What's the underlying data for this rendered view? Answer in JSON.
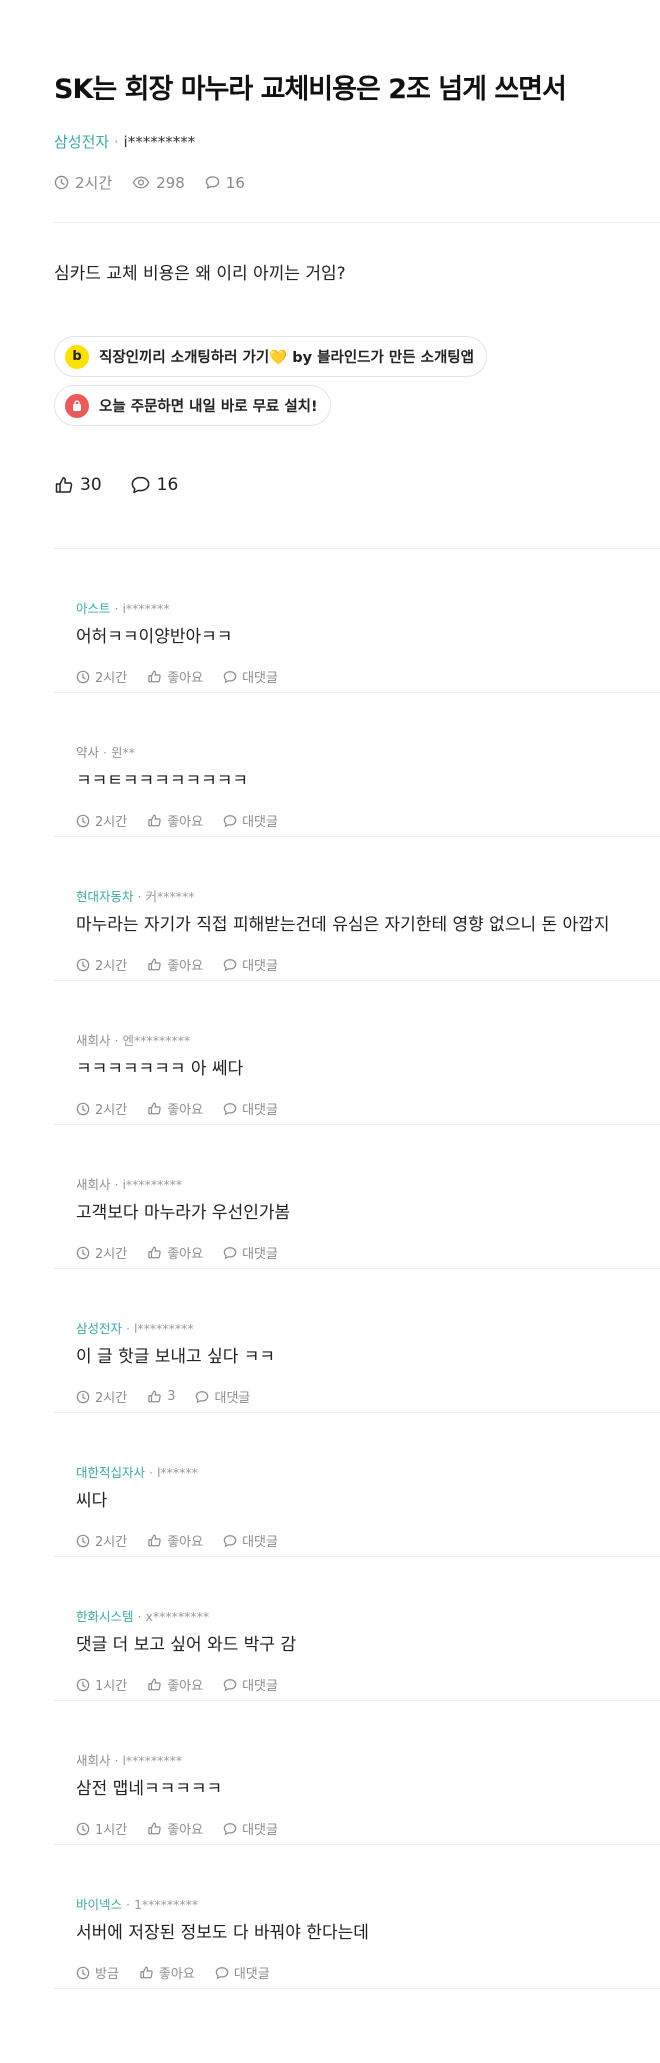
{
  "post": {
    "title": "SK는 회장 마누라 교체비용은 2조 넘게 쓰면서",
    "company": "삼성전자",
    "author": "i*********",
    "time": "2시간",
    "views": "298",
    "comments": "16",
    "body": "심카드 교체 비용은 왜 이리 아끼는 거임?",
    "likes": "30",
    "comment_count": "16"
  },
  "ads": [
    {
      "icon_letter": "b",
      "text": "직장인끼리 소개팅하러 가기💛 by 블라인드가 만든 소개팅앱"
    },
    {
      "icon_letter": "",
      "text": "오늘 주문하면 내일 바로 무료 설치!"
    }
  ],
  "colors": {
    "accent": "#3ea8a7",
    "ad_yellow": "#fce000",
    "ad_red": "#ea5a5a"
  },
  "comments": [
    {
      "company": "아스트",
      "author": "i*******",
      "text": "어허ㅋㅋ이양반아ㅋㅋ",
      "time": "2시간",
      "like": "좋아요",
      "reply": "대댓글"
    },
    {
      "company": "약사",
      "author": "윈**",
      "text": "ㅋㅋㅌㅋㅋㅋㅋㅋㅋㅋㅋ",
      "time": "2시간",
      "like": "좋아요",
      "reply": "대댓글"
    },
    {
      "company": "현대자동차",
      "author": "커******",
      "text": "마누라는 자기가 직접 피해받는건데 유심은 자기한테 영향 없으니 돈 아깝지",
      "time": "2시간",
      "like": "좋아요",
      "reply": "대댓글"
    },
    {
      "company": "새회사",
      "author": "엔*********",
      "text": "ㅋㅋㅋㅋㅋㅋㅋ 아 쎄다",
      "time": "2시간",
      "like": "좋아요",
      "reply": "대댓글"
    },
    {
      "company": "새회사",
      "author": "i*********",
      "text": "고객보다 마누라가 우선인가봄",
      "time": "2시간",
      "like": "좋아요",
      "reply": "대댓글"
    },
    {
      "company": "삼성전자",
      "author": "l*********",
      "text": "이 글 핫글 보내고 싶다 ㅋㅋ",
      "time": "2시간",
      "like": "3",
      "reply": "대댓글"
    },
    {
      "company": "대한적십자사",
      "author": "l******",
      "text": "씨다",
      "time": "2시간",
      "like": "좋아요",
      "reply": "대댓글"
    },
    {
      "company": "한화시스템",
      "author": "x*********",
      "text": "댓글 더 보고 싶어 와드 박구 감",
      "time": "1시간",
      "like": "좋아요",
      "reply": "대댓글"
    },
    {
      "company": "새회사",
      "author": "l*********",
      "text": "삼전 맵네ㅋㅋㅋㅋㅋ",
      "time": "1시간",
      "like": "좋아요",
      "reply": "대댓글"
    },
    {
      "company": "바이넥스",
      "author": "1*********",
      "text": "서버에 저장된 정보도 다 바꿔야 한다는데",
      "time": "방금",
      "like": "좋아요",
      "reply": "대댓글"
    }
  ]
}
